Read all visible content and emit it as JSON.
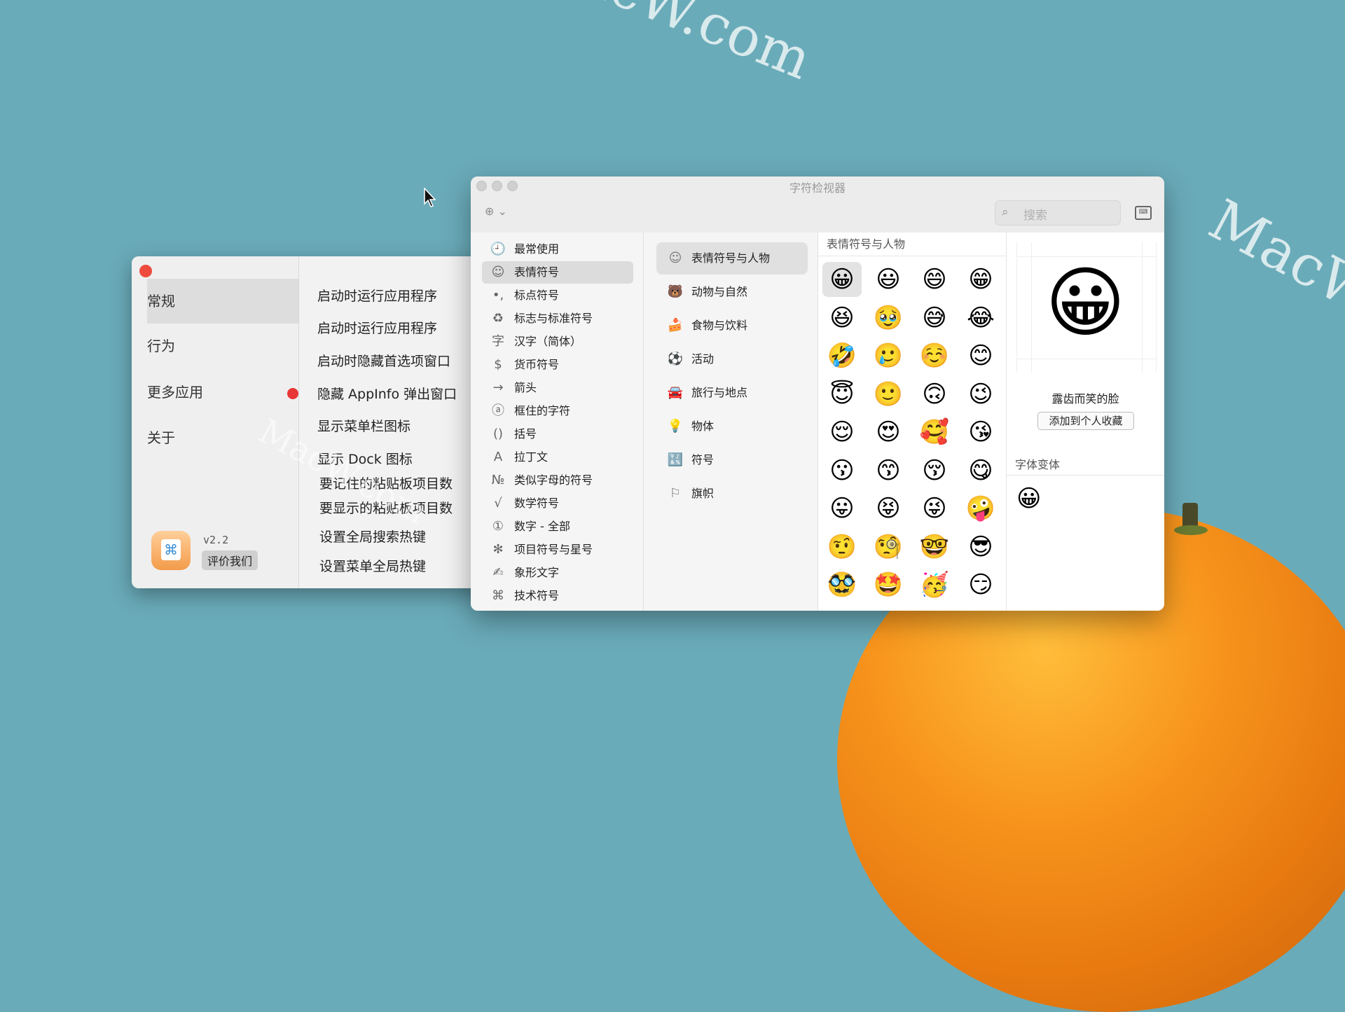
{
  "watermarks": [
    "acW.com",
    "MacW.c",
    "MacW.com"
  ],
  "appinfo": {
    "sidebar": [
      {
        "label": "常规",
        "selected": true
      },
      {
        "label": "行为",
        "selected": false
      },
      {
        "label": "更多应用",
        "selected": false
      },
      {
        "label": "关于",
        "selected": false
      }
    ],
    "version": "v2.2",
    "rate_button": "评价我们",
    "options": [
      "启动时运行应用程序",
      "启动时运行应用程序",
      "启动时隐藏首选项窗口",
      "隐藏 AppInfo 弹出窗口",
      "显示菜单栏图标",
      "显示 Dock 图标",
      "要记住的粘贴板项目数",
      "要显示的粘贴板项目数",
      "设置全局搜索热键",
      "设置菜单全局热键"
    ]
  },
  "viewer": {
    "title": "字符检视器",
    "action_icon": "⊕ ⌄",
    "search_placeholder": "搜索",
    "categories": [
      {
        "icon": "clock-icon",
        "glyph": "🕘",
        "label": "最常使用"
      },
      {
        "icon": "smiley-icon",
        "glyph": "☺",
        "label": "表情符号",
        "selected": true
      },
      {
        "icon": "punctuation-icon",
        "glyph": "•,",
        "label": "标点符号"
      },
      {
        "icon": "recycle-icon",
        "glyph": "♻",
        "label": "标志与标准符号"
      },
      {
        "icon": "hanzi-icon",
        "glyph": "字",
        "label": "汉字（简体）"
      },
      {
        "icon": "dollar-icon",
        "glyph": "$",
        "label": "货币符号"
      },
      {
        "icon": "arrow-icon",
        "glyph": "→",
        "label": "箭头"
      },
      {
        "icon": "enclosed-a-icon",
        "glyph": "ⓐ",
        "label": "框住的字符"
      },
      {
        "icon": "parentheses-icon",
        "glyph": "()",
        "label": "括号"
      },
      {
        "icon": "latin-a-icon",
        "glyph": "A",
        "label": "拉丁文"
      },
      {
        "icon": "numero-icon",
        "glyph": "№",
        "label": "类似字母的符号"
      },
      {
        "icon": "sqrt-icon",
        "glyph": "√",
        "label": "数学符号"
      },
      {
        "icon": "circled-one-icon",
        "glyph": "①",
        "label": "数字 - 全部"
      },
      {
        "icon": "asterisk-icon",
        "glyph": "✻",
        "label": "项目符号与星号"
      },
      {
        "icon": "pictograph-icon",
        "glyph": "✍",
        "label": "象形文字"
      },
      {
        "icon": "command-icon",
        "glyph": "⌘",
        "label": "技术符号"
      }
    ],
    "subcategories": [
      {
        "icon": "smiley-icon",
        "glyph": "☺",
        "label": "表情符号与人物",
        "selected": true
      },
      {
        "icon": "bear-icon",
        "glyph": "🐻",
        "label": "动物与自然"
      },
      {
        "icon": "food-icon",
        "glyph": "🍰",
        "label": "食物与饮料"
      },
      {
        "icon": "ball-icon",
        "glyph": "⚽",
        "label": "活动"
      },
      {
        "icon": "car-icon",
        "glyph": "🚘",
        "label": "旅行与地点"
      },
      {
        "icon": "bulb-icon",
        "glyph": "💡",
        "label": "物体"
      },
      {
        "icon": "symbols-icon",
        "glyph": "🔣",
        "label": "符号"
      },
      {
        "icon": "flag-icon",
        "glyph": "⚐",
        "label": "旗帜"
      }
    ],
    "grid_header": "表情符号与人物",
    "emojis": [
      "😀",
      "😃",
      "😄",
      "😁",
      "😆",
      "🥹",
      "😅",
      "😂",
      "🤣",
      "🥲",
      "☺️",
      "😊",
      "😇",
      "🙂",
      "🙃",
      "😉",
      "😌",
      "😍",
      "🥰",
      "😘",
      "😗",
      "😙",
      "😚",
      "😋",
      "😛",
      "😝",
      "😜",
      "🤪",
      "🤨",
      "🧐",
      "🤓",
      "😎",
      "🥸",
      "🤩",
      "🥳",
      "😏"
    ],
    "detail": {
      "emoji": "😀",
      "name": "露齿而笑的脸",
      "add_favorite": "添加到个人收藏",
      "variants_header": "字体变体",
      "variant": "😀"
    }
  }
}
